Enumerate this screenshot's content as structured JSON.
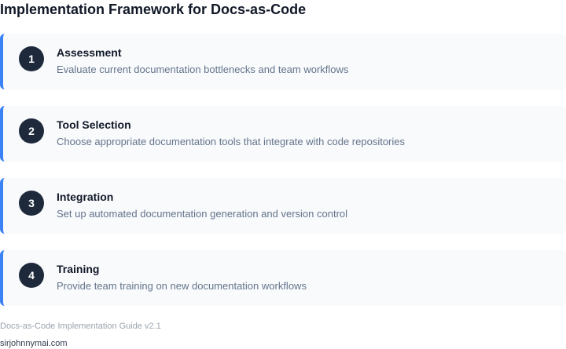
{
  "page": {
    "title": "Implementation Framework for Docs-as-Code"
  },
  "steps": [
    {
      "number": "1",
      "title": "Assessment",
      "description": "Evaluate current documentation bottlenecks and team workflows"
    },
    {
      "number": "2",
      "title": "Tool Selection",
      "description": "Choose appropriate documentation tools that integrate with code repositories"
    },
    {
      "number": "3",
      "title": "Integration",
      "description": "Set up automated documentation generation and version control"
    },
    {
      "number": "4",
      "title": "Training",
      "description": "Provide team training on new documentation workflows"
    }
  ],
  "footer": {
    "note": "Docs-as-Code Implementation Guide v2.1",
    "site": "sirjohnnymai.com"
  },
  "colors": {
    "accent": "#3b82f6",
    "badge": "#1e293b",
    "card_background": "#f8fafc"
  }
}
